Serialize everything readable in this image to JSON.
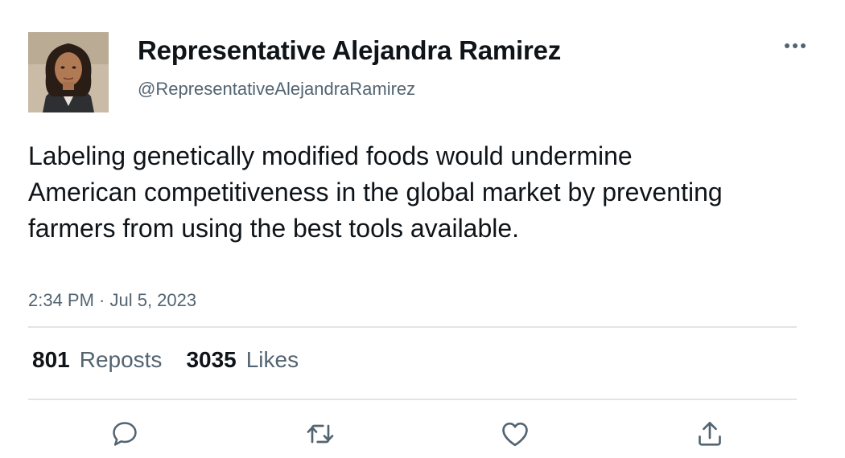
{
  "author": {
    "display_name": "Representative Alejandra Ramirez",
    "handle": "@RepresentativeAlejandraRamirez",
    "avatar_icon": "profile-photo"
  },
  "tweet": {
    "text": "Labeling genetically modified foods would undermine American competitiveness in the global market by preventing farmers from using the best tools available.",
    "timestamp": "2:34 PM · Jul 5, 2023"
  },
  "stats": {
    "reposts_count": "801",
    "reposts_label": "Reposts",
    "likes_count": "3035",
    "likes_label": "Likes"
  },
  "actions": {
    "reply_icon": "speech-bubble-icon",
    "repost_icon": "repost-arrows-icon",
    "like_icon": "heart-icon",
    "share_icon": "share-upload-icon",
    "more_icon": "ellipsis-icon"
  },
  "colors": {
    "text_primary": "#0f1419",
    "text_secondary": "#536471",
    "divider": "#e1e4e8",
    "icon": "#536471"
  }
}
